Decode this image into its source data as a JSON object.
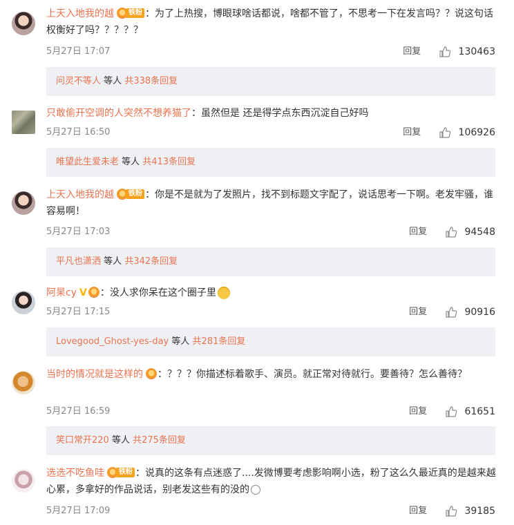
{
  "comments": [
    {
      "username": "上天入地我的越",
      "fan_badge": "铁粉",
      "text": "：为了上热搜，博眼球啥话都说，啥都不管了，不思考一下在发言吗？？说这句话权衡好了吗？？？？？",
      "date": "5月27日 17:07",
      "reply_label": "回复",
      "likes": "130463",
      "reply_box": {
        "user": "问灵不等人",
        "mid": "等人",
        "link": "共338条回复"
      }
    },
    {
      "username": "只敢偷开空调的人突然不想养猫了",
      "text": "：虽然但是 还是得学点东西沉淀自己好吗",
      "date": "5月27日 16:50",
      "reply_label": "回复",
      "likes": "106926",
      "reply_box": {
        "user": "唯望此生爱未老",
        "mid": "等人",
        "link": "共413条回复"
      }
    },
    {
      "username": "上天入地我的越",
      "fan_badge": "铁粉",
      "text": "：你是不是就为了发照片，找不到标题文字配了，说话思考一下啊。老发牢骚，谁容易啊！",
      "date": "5月27日 17:03",
      "reply_label": "回复",
      "likes": "94548",
      "reply_box": {
        "user": "平凡也潇洒",
        "mid": "等人",
        "link": "共342条回复"
      }
    },
    {
      "username": "阿杲cy",
      "text": "：没人求你呆在这个圈子里",
      "date": "5月27日 17:15",
      "reply_label": "回复",
      "likes": "90916",
      "reply_box": {
        "user": "Lovegood_Ghost-yes-day",
        "mid": "等人",
        "link": "共281条回复"
      }
    },
    {
      "username": "当时的情况就是这样的",
      "text": "：？？？你描述标着歌手、演员。就正常对待就行。要善待？怎么善待？",
      "date": "5月27日 16:59",
      "reply_label": "回复",
      "likes": "61651",
      "reply_box": {
        "user": "笑口常开220",
        "mid": "等人",
        "link": "共275条回复"
      }
    },
    {
      "username": "选选不吃鱼哇",
      "fan_badge": "铁粉",
      "text": "：说真的这条有点迷惑了....发微博要考虑影响啊小选，粉了这么久最近真的是越来越心累，多拿好的作品说话，别老发这些有的没的",
      "date": "5月27日 17:09",
      "reply_label": "回复",
      "likes": "39185"
    }
  ],
  "colors": {
    "username": "#eb7350",
    "reply_bg": "#eef0f4",
    "fan_badge": "#f7a21b"
  }
}
